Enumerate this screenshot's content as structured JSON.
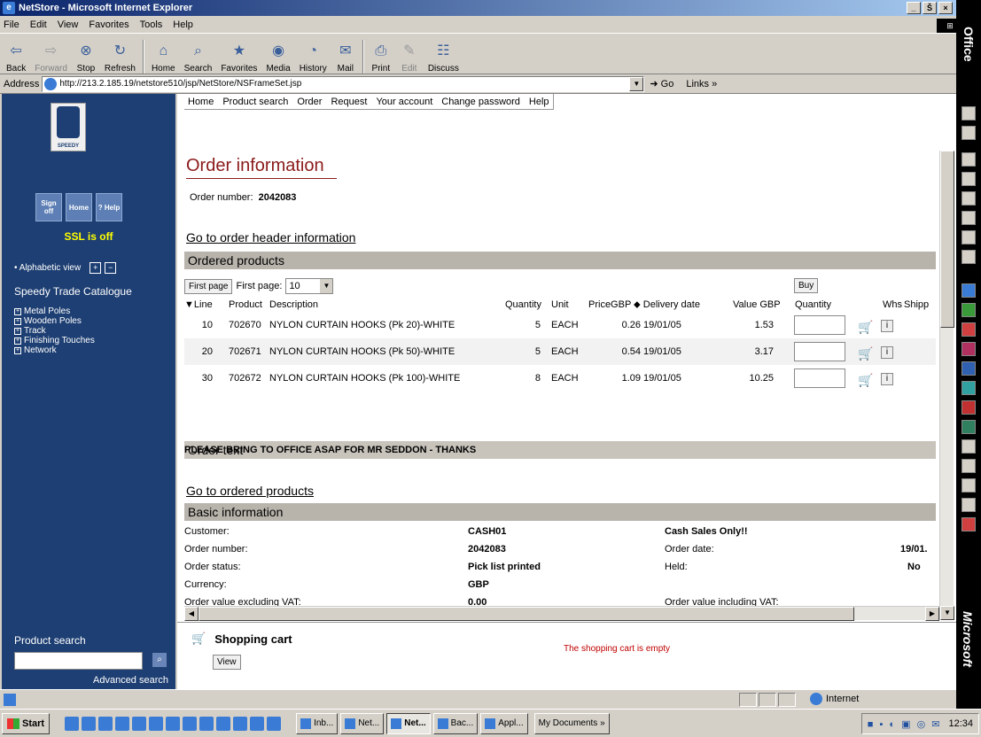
{
  "window": {
    "title": "NetStore - Microsoft Internet Explorer",
    "min": "_",
    "max": "Š",
    "close": "×"
  },
  "menu": [
    "File",
    "Edit",
    "View",
    "Favorites",
    "Tools",
    "Help"
  ],
  "toolbar": [
    {
      "label": "Back",
      "icon": "back-icon",
      "glyph": "⇦"
    },
    {
      "label": "Forward",
      "icon": "forward-icon",
      "glyph": "⇨",
      "disabled": true
    },
    {
      "label": "Stop",
      "icon": "stop-icon",
      "glyph": "⊗"
    },
    {
      "label": "Refresh",
      "icon": "refresh-icon",
      "glyph": "↻"
    },
    {
      "label": "Home",
      "icon": "home-icon",
      "glyph": "⌂"
    },
    {
      "label": "Search",
      "icon": "search-icon",
      "glyph": "⌕"
    },
    {
      "label": "Favorites",
      "icon": "favorites-icon",
      "glyph": "★"
    },
    {
      "label": "Media",
      "icon": "media-icon",
      "glyph": "◉"
    },
    {
      "label": "History",
      "icon": "history-icon",
      "glyph": "◔"
    },
    {
      "label": "Mail",
      "icon": "mail-icon",
      "glyph": "✉"
    },
    {
      "label": "Print",
      "icon": "print-icon",
      "glyph": "⎙"
    },
    {
      "label": "Edit",
      "icon": "edit-icon",
      "glyph": "✎",
      "disabled": true
    },
    {
      "label": "Discuss",
      "icon": "discuss-icon",
      "glyph": "☷"
    }
  ],
  "address": {
    "label": "Address",
    "url": "http://213.2.185.19/netstore510/jsp/NetStore/NSFrameSet.jsp",
    "go": "Go",
    "links": "Links »"
  },
  "left": {
    "logo_text": "SPEEDY",
    "buttons": [
      "Sign off",
      "Home",
      "? Help"
    ],
    "ssl": "SSL is off",
    "alpha_view": "• Alphabetic view",
    "catalogue_title": "Speedy Trade Catalogue",
    "categories": [
      "Metal Poles",
      "Wooden Poles",
      "Track",
      "Finishing Touches",
      "Network"
    ],
    "product_search": "Product search",
    "advanced_search": "Advanced search"
  },
  "topnav": [
    "Home",
    "Product search",
    "Order",
    "Request",
    "Your account",
    "Change password",
    "Help"
  ],
  "page": {
    "title": "Order information",
    "order_number_label": "Order number:",
    "order_number": "2042083",
    "header_link": "Go to order header information",
    "ordered_products": "Ordered products",
    "first_page_btn": "First page",
    "first_page_label": "First page:",
    "page_size": "10",
    "buy": "Buy",
    "columns": [
      "▼Line",
      "Product",
      "Description",
      "Quantity",
      "Unit",
      "PriceGBP",
      "⬥ Delivery date",
      "Value GBP",
      "Quantity",
      "Whs",
      "Shipp"
    ],
    "rows": [
      {
        "line": "10",
        "product": "702670",
        "desc": "NYLON CURTAIN HOOKS (Pk 20)-WHITE",
        "qty": "5",
        "unit": "EACH",
        "price": "0.26",
        "date": "19/01/05",
        "value": "1.53"
      },
      {
        "line": "20",
        "product": "702671",
        "desc": "NYLON CURTAIN HOOKS (Pk 50)-WHITE",
        "qty": "5",
        "unit": "EACH",
        "price": "0.54",
        "date": "19/01/05",
        "value": "3.17"
      },
      {
        "line": "30",
        "product": "702672",
        "desc": "NYLON CURTAIN HOOKS (Pk 100)-WHITE",
        "qty": "8",
        "unit": "EACH",
        "price": "1.09",
        "date": "19/01/05",
        "value": "10.25"
      }
    ],
    "order_text_title": "Order text",
    "order_text": "PLEASE BRING TO OFFICE ASAP FOR MR SEDDON - THANKS",
    "ordered_link": "Go to ordered products",
    "basic_info": "Basic information",
    "info": {
      "customer_label": "Customer:",
      "customer": "CASH01",
      "customer_name": "Cash Sales Only!!",
      "ordnum_label": "Order number:",
      "ordnum": "2042083",
      "orddate_label": "Order date:",
      "orddate": "19/01.",
      "status_label": "Order status:",
      "status": "Pick list printed",
      "held_label": "Held:",
      "held": "No",
      "currency_label": "Currency:",
      "currency": "GBP",
      "excl_label": "Order value excluding VAT:",
      "excl": "0.00",
      "incl_label": "Order value including VAT:"
    }
  },
  "cart": {
    "title": "Shopping cart",
    "view": "View",
    "empty": "The shopping cart is empty"
  },
  "status": {
    "zone": "Internet"
  },
  "taskbar": {
    "start": "Start",
    "tasks": [
      "Inb...",
      "Net...",
      "Net...",
      "Bac...",
      "Appl..."
    ],
    "docs": "My Documents »",
    "time": "12:34"
  },
  "office": {
    "label": "Office",
    "ms": "Microsoft"
  }
}
